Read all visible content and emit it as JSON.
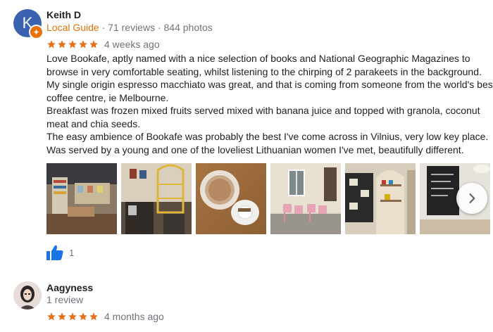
{
  "reviews": [
    {
      "author": "Keith D",
      "avatar_letter": "K",
      "badge": "Local Guide",
      "stats": " · 71 reviews · 844 photos",
      "rating": 5,
      "time": "4 weeks ago",
      "text": [
        "Love Bookafe, aptly named with a nice selection of books and National Geographic Magazines to",
        "browse in very comfortable seating, whilst listening to the chirping of 2 parakeets in the background.",
        "My single origin espresso macchiato was great, and that is coming from someone from the world's best",
        "coffee centre, ie Melbourne.",
        "Breakfast was frozen mixed fruits served mixed with banana juice and topped with granola, coconut",
        "meat and chia seeds.",
        "The easy ambience of Bookafe was probably the best I've come across in Vilnius, very low key place.",
        "Was served by a young and one of the loveliest Lithuanian women I've met, beautifully different."
      ],
      "photos": [
        "cafe-interior-photo",
        "shelf-lamp-photo",
        "coffee-cup-photo",
        "street-terrace-photo",
        "chalkboard-wall-photo",
        "menu-board-photo"
      ],
      "likes": "1"
    },
    {
      "author": "Aagyness",
      "stats": "1 review",
      "rating": 5,
      "time": "4 months ago"
    }
  ],
  "colors": {
    "star": "#e7711b",
    "local_guide": "#e8710a",
    "like": "#1a73e8",
    "avatar_k": "#3a62b0"
  },
  "icons": [
    "local-guide-badge-icon",
    "star-icon",
    "thumbs-up-icon",
    "chevron-right-icon"
  ]
}
